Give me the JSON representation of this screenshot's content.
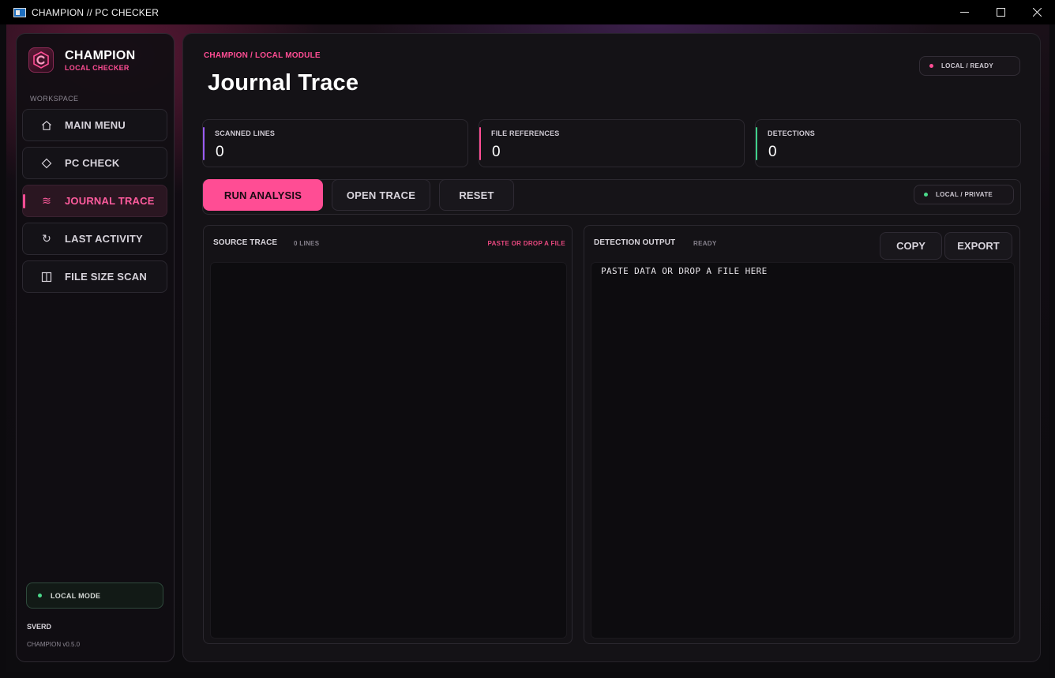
{
  "window": {
    "title": "CHAMPION // PC CHECKER",
    "controls": [
      "minimize",
      "maximize",
      "close"
    ]
  },
  "sidebar": {
    "brand_name": "CHAMPION",
    "brand_sub": "LOCAL CHECKER",
    "section_label": "WORKSPACE",
    "items": [
      {
        "label": "MAIN MENU",
        "icon": "home-icon"
      },
      {
        "label": "PC CHECK",
        "icon": "diamond-icon"
      },
      {
        "label": "JOURNAL TRACE",
        "icon": "wave-icon",
        "active": true
      },
      {
        "label": "LAST ACTIVITY",
        "icon": "refresh-icon"
      },
      {
        "label": "FILE SIZE SCAN",
        "icon": "columns-icon"
      }
    ],
    "mode_label": "LOCAL MODE",
    "user": "SVERD",
    "version": "CHAMPION v0.5.0"
  },
  "header": {
    "breadcrumb": "CHAMPION / LOCAL MODULE",
    "title": "Journal Trace",
    "status": "LOCAL / READY"
  },
  "stats": [
    {
      "label": "SCANNED LINES",
      "value": "0",
      "accent": "#9b5cff"
    },
    {
      "label": "FILE REFERENCES",
      "value": "0",
      "accent": "#ff4d94"
    },
    {
      "label": "DETECTIONS",
      "value": "0",
      "accent": "#3fd18a"
    }
  ],
  "toolbar": {
    "run_label": "RUN ANALYSIS",
    "open_label": "OPEN TRACE",
    "reset_label": "RESET",
    "privacy_label": "LOCAL / PRIVATE"
  },
  "source_pane": {
    "title": "SOURCE TRACE",
    "line_count": "0 LINES",
    "hint": "PASTE OR DROP A FILE",
    "content": ""
  },
  "output_pane": {
    "title": "DETECTION OUTPUT",
    "status": "READY",
    "copy_label": "COPY",
    "export_label": "EXPORT",
    "content": "PASTE DATA OR DROP A FILE HERE"
  },
  "colors": {
    "accent": "#ff4d94",
    "success": "#4bd98a",
    "background": "#0c0b0e"
  }
}
